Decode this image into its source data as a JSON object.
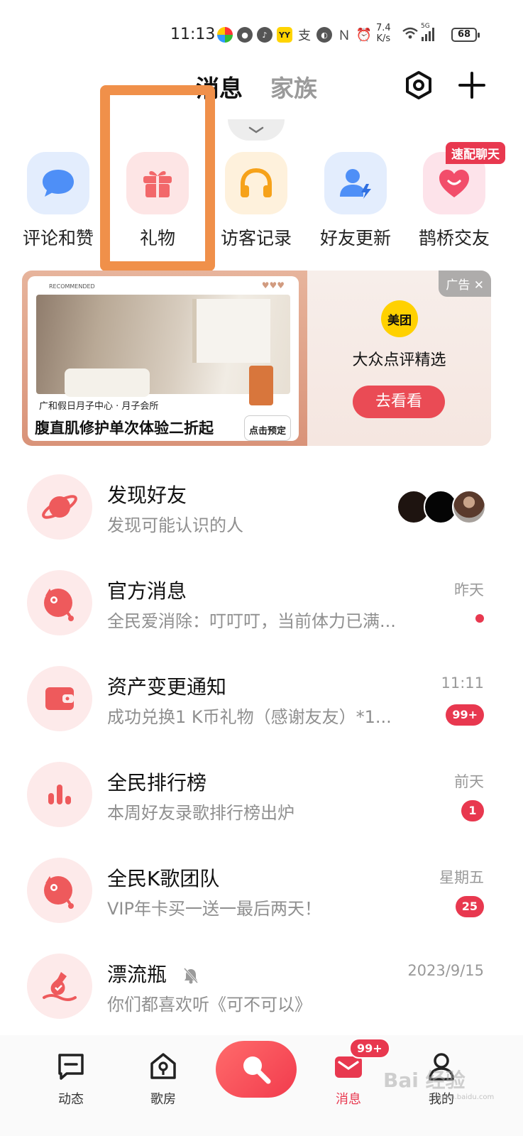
{
  "status_bar": {
    "time": "11:13",
    "net_speed_value": "7.4",
    "net_speed_unit": "K/s",
    "network": "5G",
    "battery": "68",
    "yy_label": "YY"
  },
  "header": {
    "tabs": [
      {
        "label": "消息",
        "active": true
      },
      {
        "label": "家族",
        "active": false
      }
    ]
  },
  "quick_entries": {
    "items": [
      {
        "label": "评论和赞",
        "icon": "comment-bubble-icon",
        "color": "#4e8ff7"
      },
      {
        "label": "礼物",
        "icon": "gift-icon",
        "color": "#f2686a"
      },
      {
        "label": "访客记录",
        "icon": "headphones-icon",
        "color": "#f6a21a"
      },
      {
        "label": "好友更新",
        "icon": "friend-update-icon",
        "color": "#4e8ff7"
      },
      {
        "label": "鹊桥交友",
        "icon": "heart-smile-icon",
        "color": "#f24d6a"
      }
    ],
    "badge": "速配聊天"
  },
  "ad": {
    "card_top": "RECOMMENDED",
    "subtitle": "广和假日月子中心 · 月子会所",
    "title": "腹直肌修护单次体验二折起",
    "book_label": "点击预定",
    "tag": "广告 ✕",
    "logo_text": "美团",
    "brand": "大众点评精选",
    "cta": "去看看"
  },
  "messages": [
    {
      "title": "发现好友",
      "subtitle": "发现可能认识的人",
      "time": "",
      "badge": "",
      "icon": "planet-icon"
    },
    {
      "title": "官方消息",
      "subtitle": "全民爱消除：叮叮叮，当前体力已满...",
      "time": "昨天",
      "badge": "",
      "icon": "official-mascot-icon"
    },
    {
      "title": "资产变更通知",
      "subtitle": "成功兑换1 K币礼物（感谢友友）*1...",
      "time": "11:11",
      "badge": "99+",
      "icon": "wallet-icon"
    },
    {
      "title": "全民排行榜",
      "subtitle": "本周好友录歌排行榜出炉",
      "time": "前天",
      "badge": "1",
      "icon": "ranking-bars-icon"
    },
    {
      "title": "全民K歌团队",
      "subtitle": "VIP年卡买一送一最后两天！",
      "time": "星期五",
      "badge": "25",
      "icon": "team-mascot-icon"
    },
    {
      "title": "漂流瓶",
      "subtitle": "你们都喜欢听《可不可以》",
      "time": "2023/9/15",
      "badge": "",
      "icon": "drift-bottle-icon"
    }
  ],
  "bottom_nav": {
    "items": [
      {
        "label": "动态",
        "icon": "feed-icon"
      },
      {
        "label": "歌房",
        "icon": "song-room-icon"
      },
      {
        "label": "消息",
        "icon": "message-icon",
        "active": true
      },
      {
        "label": "我的",
        "icon": "profile-icon"
      }
    ],
    "message_badge": "99+"
  },
  "watermark": {
    "text": "Bai 经验",
    "sub": "jingyan.baidu.com"
  },
  "colors": {
    "accent": "#e8384f",
    "highlight": "#f0904a"
  }
}
